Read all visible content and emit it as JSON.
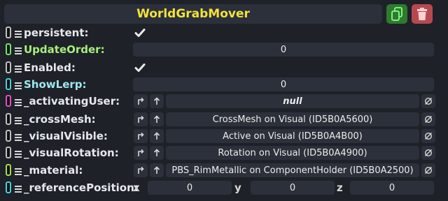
{
  "header": {
    "title": "WorldGrabMover"
  },
  "icons": {
    "duplicate": "duplicate-icon",
    "delete": "trash-icon",
    "checkbox": "checkmark-icon",
    "jump": "jump-to-icon",
    "up": "arrow-up-icon",
    "clear": "null-clear-icon"
  },
  "colors": {
    "title": "#f3e23a",
    "duplicate_bg": "#2f7a2f",
    "delete_bg": "#b8484f"
  },
  "fields": [
    {
      "label": "persistent",
      "type": "bool",
      "checked": true,
      "label_color": "#e6e8ec",
      "swatch_color": "#bfbfbf"
    },
    {
      "label": "UpdateOrder",
      "type": "number",
      "value": "0",
      "label_color": "#a7ef7a",
      "swatch_color": "#6fe36f"
    },
    {
      "label": "Enabled",
      "type": "bool",
      "checked": true,
      "label_color": "#e6e8ec",
      "swatch_color": "#bfbfbf"
    },
    {
      "label": "ShowLerp",
      "type": "number",
      "value": "0",
      "label_color": "#9ee7ee",
      "swatch_color": "#47cfd6"
    },
    {
      "label": "_activatingUser",
      "type": "ref",
      "value": "null",
      "italic": true,
      "label_color": "#e6e8ec",
      "swatch_color": "#e44cc2"
    },
    {
      "label": "_crossMesh",
      "type": "ref",
      "value": "CrossMesh on Visual (ID5B0A5600)",
      "label_color": "#e6e8ec",
      "swatch_color": "#bfbfbf"
    },
    {
      "label": "_visualVisible",
      "type": "ref",
      "value": "Active on Visual (ID5B0A4B00)",
      "label_color": "#e6e8ec",
      "swatch_color": "#bfbfbf"
    },
    {
      "label": "_visualRotation",
      "type": "ref",
      "value": "Rotation on Visual (ID5B0A4900)",
      "label_color": "#e6e8ec",
      "swatch_color": "#bfbfbf"
    },
    {
      "label": "_material",
      "type": "ref",
      "value": "PBS_RimMetallic on ComponentHolder (ID5B0A2500)",
      "label_color": "#e6e8ec",
      "swatch_color": "#a7d84a"
    },
    {
      "label": "_referencePosition",
      "type": "vector",
      "x": "0",
      "y": "0",
      "z": "0",
      "axis_x": "x",
      "axis_y": "y",
      "axis_z": "z",
      "label_color": "#e6e8ec",
      "swatch_color": "#47cfd6"
    }
  ]
}
